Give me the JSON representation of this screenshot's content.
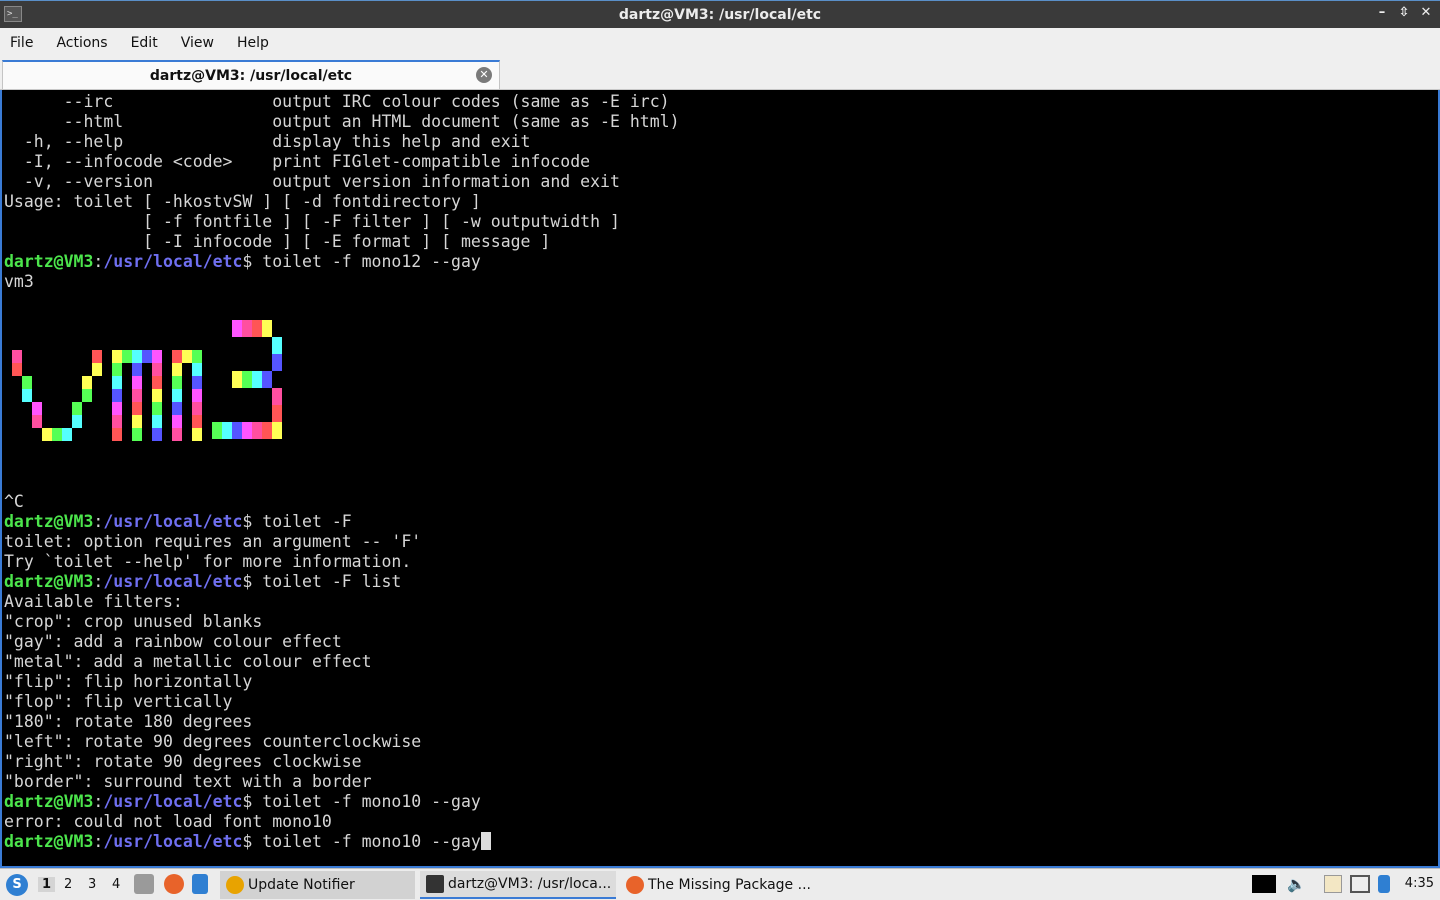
{
  "window": {
    "title": "dartz@VM3: /usr/local/etc"
  },
  "menu": [
    "File",
    "Actions",
    "Edit",
    "View",
    "Help"
  ],
  "tab": {
    "label": "dartz@VM3: /usr/local/etc"
  },
  "prompt": {
    "user": "dartz@VM3",
    "path": "/usr/local/etc"
  },
  "terminal_lines": [
    {
      "t": "out",
      "text": "      --irc                output IRC colour codes (same as -E irc)"
    },
    {
      "t": "out",
      "text": "      --html               output an HTML document (same as -E html)"
    },
    {
      "t": "out",
      "text": "  -h, --help               display this help and exit"
    },
    {
      "t": "out",
      "text": "  -I, --infocode <code>    print FIGlet-compatible infocode"
    },
    {
      "t": "out",
      "text": "  -v, --version            output version information and exit"
    },
    {
      "t": "out",
      "text": "Usage: toilet [ -hkostvSW ] [ -d fontdirectory ]"
    },
    {
      "t": "out",
      "text": "              [ -f fontfile ] [ -F filter ] [ -w outputwidth ]"
    },
    {
      "t": "out",
      "text": "              [ -I infocode ] [ -E format ] [ message ]"
    },
    {
      "t": "cmd",
      "text": " toilet -f mono12 --gay"
    },
    {
      "t": "out",
      "text": "vm3"
    },
    {
      "t": "out",
      "text": ""
    },
    {
      "t": "out",
      "text": ""
    },
    {
      "t": "out",
      "text": ""
    },
    {
      "t": "out",
      "text": ""
    },
    {
      "t": "out",
      "text": ""
    },
    {
      "t": "out",
      "text": ""
    },
    {
      "t": "out",
      "text": ""
    },
    {
      "t": "out",
      "text": ""
    },
    {
      "t": "out",
      "text": ""
    },
    {
      "t": "out",
      "text": ""
    },
    {
      "t": "out",
      "text": "^C"
    },
    {
      "t": "cmd",
      "text": " toilet -F"
    },
    {
      "t": "out",
      "text": "toilet: option requires an argument -- 'F'"
    },
    {
      "t": "out",
      "text": "Try `toilet --help' for more information."
    },
    {
      "t": "cmd",
      "text": " toilet -F list"
    },
    {
      "t": "out",
      "text": "Available filters:"
    },
    {
      "t": "out",
      "text": "\"crop\": crop unused blanks"
    },
    {
      "t": "out",
      "text": "\"gay\": add a rainbow colour effect"
    },
    {
      "t": "out",
      "text": "\"metal\": add a metallic colour effect"
    },
    {
      "t": "out",
      "text": "\"flip\": flip horizontally"
    },
    {
      "t": "out",
      "text": "\"flop\": flip vertically"
    },
    {
      "t": "out",
      "text": "\"180\": rotate 180 degrees"
    },
    {
      "t": "out",
      "text": "\"left\": rotate 90 degrees counterclockwise"
    },
    {
      "t": "out",
      "text": "\"right\": rotate 90 degrees clockwise"
    },
    {
      "t": "out",
      "text": "\"border\": surround text with a border"
    },
    {
      "t": "cmd",
      "text": " toilet -f mono10 --gay"
    },
    {
      "t": "out",
      "text": "error: could not load font mono10"
    },
    {
      "t": "cmd",
      "text": " toilet -f mono10 --gay",
      "cursor": true
    }
  ],
  "banner": {
    "text": "vm3",
    "palette": [
      "#ff4fa0",
      "#ff5555",
      "#ffff55",
      "#55ff55",
      "#55ffff",
      "#5555ff",
      "#ff55ff"
    ]
  },
  "taskbar": {
    "desktops": [
      "1",
      "2",
      "3",
      "4"
    ],
    "tasks": [
      {
        "label": "Update Notifier",
        "state": "inactive",
        "icon_color": "#e8a300"
      },
      {
        "label": "dartz@VM3: /usr/loca...",
        "state": "active",
        "icon_color": "#333333"
      },
      {
        "label": "The Missing Package ...",
        "state": "normal",
        "icon_color": "#e8632a"
      }
    ],
    "clock": "4:35"
  }
}
